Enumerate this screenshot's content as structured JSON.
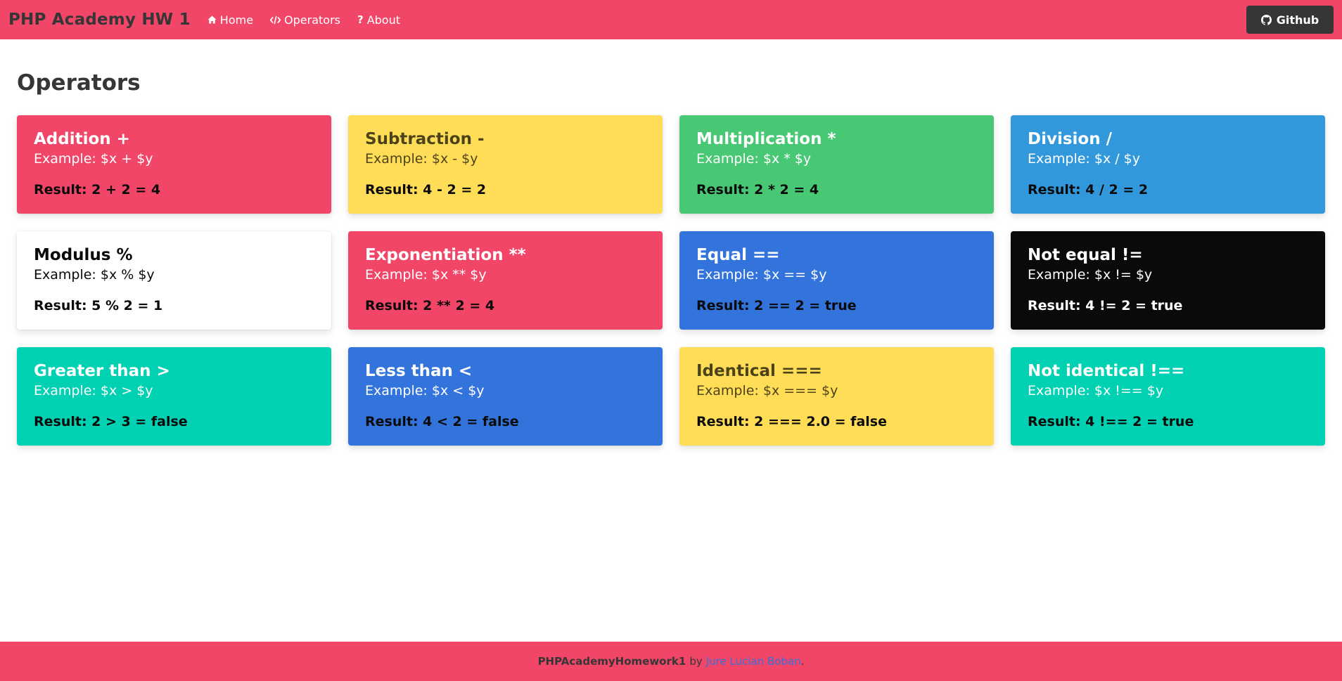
{
  "navbar": {
    "brand": "PHP Academy HW 1",
    "links": [
      {
        "label": "Home",
        "icon": "home-icon"
      },
      {
        "label": "Operators",
        "icon": "code-icon"
      },
      {
        "label": "About",
        "icon": "question-icon"
      }
    ],
    "github_label": "Github",
    "github_icon": "github-icon"
  },
  "page": {
    "title": "Operators"
  },
  "cards": [
    {
      "title": "Addition +",
      "example": "Example: $x + $y",
      "result": "Result: 2 + 2 = 4",
      "theme": "danger"
    },
    {
      "title": "Subtraction -",
      "example": "Example: $x - $y",
      "result": "Result: 4 - 2 = 2",
      "theme": "warning"
    },
    {
      "title": "Multiplication *",
      "example": "Example: $x * $y",
      "result": "Result: 2 * 2 = 4",
      "theme": "success"
    },
    {
      "title": "Division /",
      "example": "Example: $x / $y",
      "result": "Result: 4 / 2 = 2",
      "theme": "info"
    },
    {
      "title": "Modulus %",
      "example": "Example: $x % $y",
      "result": "Result: 5 % 2 = 1",
      "theme": "white"
    },
    {
      "title": "Exponentiation **",
      "example": "Example: $x ** $y",
      "result": "Result: 2 ** 2 = 4",
      "theme": "danger"
    },
    {
      "title": "Equal ==",
      "example": "Example: $x == $y",
      "result": "Result: 2 == 2 = true",
      "theme": "link"
    },
    {
      "title": "Not equal !=",
      "example": "Example: $x != $y",
      "result": "Result: 4 != 2 = true",
      "theme": "black"
    },
    {
      "title": "Greater than >",
      "example": "Example: $x > $y",
      "result": "Result: 2 > 3 = false",
      "theme": "primary"
    },
    {
      "title": "Less than <",
      "example": "Example: $x < $y",
      "result": "Result: 4 < 2 = false",
      "theme": "link"
    },
    {
      "title": "Identical ===",
      "example": "Example: $x === $y",
      "result": "Result: 2 === 2.0 = false",
      "theme": "warning"
    },
    {
      "title": "Not identical !==",
      "example": "Example: $x !== $y",
      "result": "Result: 4 !== 2 = true",
      "theme": "primary"
    }
  ],
  "footer": {
    "project": "PHPAcademyHomework1",
    "by": "by",
    "author": "Jure Lucian Boban",
    "trailing": "."
  },
  "colors": {
    "primary": "#00d1b2",
    "link": "#3273dc",
    "info": "#3298dc",
    "success": "#48c774",
    "warning": "#ffdd57",
    "danger": "#f14668",
    "dark": "#363636",
    "black": "#0a0a0a",
    "white": "#ffffff"
  }
}
